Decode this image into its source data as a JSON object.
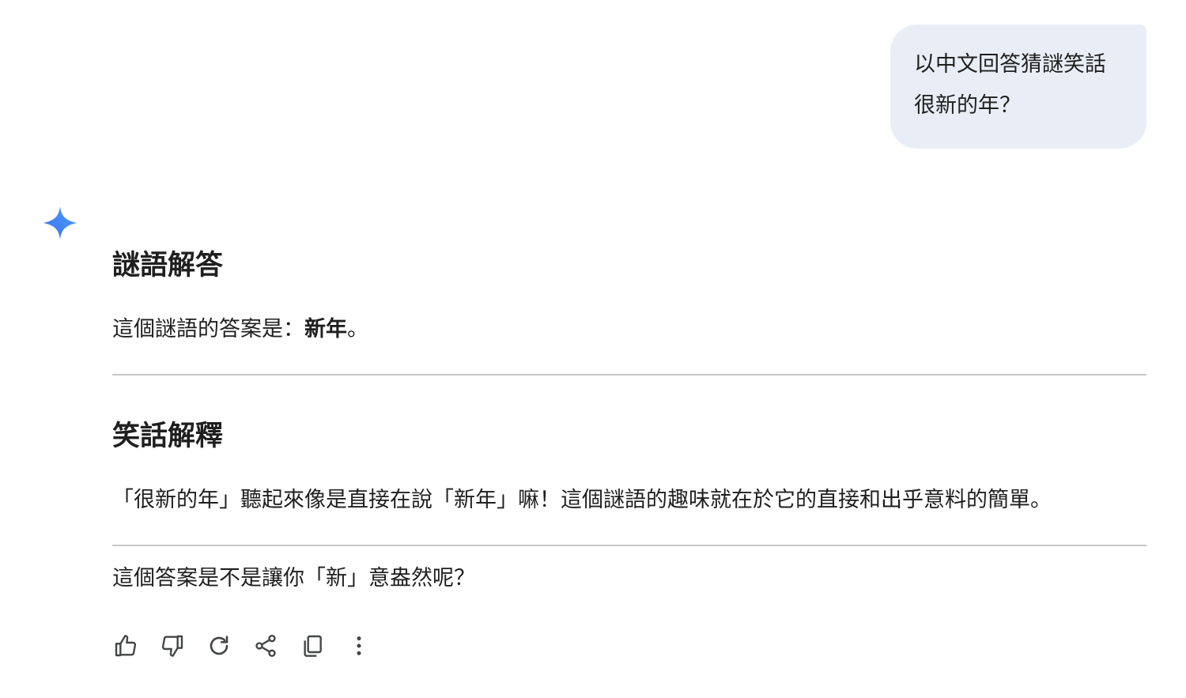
{
  "user_message": {
    "line1": "以中文回答猜謎笑話",
    "line2": "很新的年？"
  },
  "response": {
    "section1": {
      "heading": "謎語解答",
      "text_before": "這個謎語的答案是：",
      "answer_bold": "新年",
      "text_after": "。"
    },
    "section2": {
      "heading": "笑話解釋",
      "text": "「很新的年」聽起來像是直接在說「新年」嘛！這個謎語的趣味就在於它的直接和出乎意料的簡單。"
    },
    "closing": "這個答案是不是讓你「新」意盎然呢？"
  },
  "actions": [
    {
      "name": "thumbs-up-icon"
    },
    {
      "name": "thumbs-down-icon"
    },
    {
      "name": "regenerate-icon"
    },
    {
      "name": "share-icon"
    },
    {
      "name": "copy-icon"
    },
    {
      "name": "more-options-icon"
    }
  ],
  "colors": {
    "bubble_bg": "#e9eef6",
    "spark_blue": "#4285f4",
    "text": "#1f1f1f",
    "divider": "#c7c7c7"
  }
}
